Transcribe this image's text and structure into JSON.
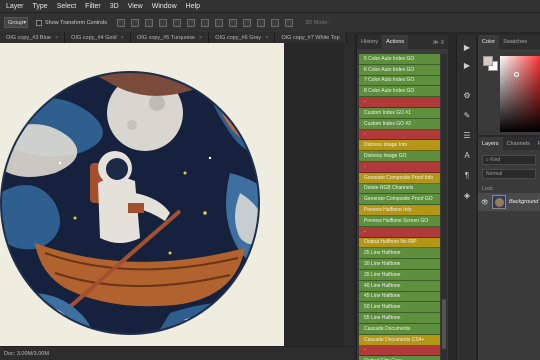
{
  "menu": [
    "Layer",
    "Type",
    "Select",
    "Filter",
    "3D",
    "View",
    "Window",
    "Help"
  ],
  "options_bar": {
    "auto_select_value": "Group",
    "show_transform_label": "Show Transform Controls",
    "mode_3d_label": "3D Mode:"
  },
  "doc_tabs": [
    "OIG copy_#3 Blue",
    "OIG copy_#4 Gold",
    "OIG copy_#5 Turquoise",
    "OIG copy_#6 Gray",
    "OIG copy_#7 White Top"
  ],
  "status": {
    "doc_size": "Doc: 3.00M/3.00M"
  },
  "actions_panel": {
    "tabs": [
      "History",
      "Actions"
    ],
    "active_tab": "Actions",
    "rows": [
      {
        "label": "5 Color Auto Index GO",
        "color": "#5e8f3c"
      },
      {
        "label": "6 Color Auto Index GO",
        "color": "#5e8f3c"
      },
      {
        "label": "7 Color Auto Index GO",
        "color": "#5e8f3c"
      },
      {
        "label": "8 Color Auto Index GO",
        "color": "#5e8f3c"
      },
      {
        "label": "-",
        "color": "#b03a3a"
      },
      {
        "label": "Custom Index GO #1",
        "color": "#5e8f3c"
      },
      {
        "label": "Custom Index GO #2",
        "color": "#5e8f3c"
      },
      {
        "label": "-",
        "color": "#b03a3a"
      },
      {
        "label": "Distress Image Info",
        "color": "#b39613"
      },
      {
        "label": "Distress Image GO",
        "color": "#5e8f3c"
      },
      {
        "label": "-",
        "color": "#b03a3a"
      },
      {
        "label": "Generate Composite Proof Info",
        "color": "#b39613"
      },
      {
        "label": "Delete RGB Channels",
        "color": "#5e8f3c"
      },
      {
        "label": "Generate Composite Proof GO",
        "color": "#5e8f3c"
      },
      {
        "label": "Preview Halftone Info",
        "color": "#b39613"
      },
      {
        "label": "Preview Halftone Screen GO",
        "color": "#5e8f3c"
      },
      {
        "label": "-",
        "color": "#b03a3a"
      },
      {
        "label": "Output Halftone No RIP",
        "color": "#b39613"
      },
      {
        "label": "25 Line Halftone",
        "color": "#5e8f3c"
      },
      {
        "label": "30 Line Halftone",
        "color": "#5e8f3c"
      },
      {
        "label": "35 Line Halftone",
        "color": "#5e8f3c"
      },
      {
        "label": "40 Line Halftone",
        "color": "#5e8f3c"
      },
      {
        "label": "45 Line Halftone",
        "color": "#5e8f3c"
      },
      {
        "label": "50 Line Halftone",
        "color": "#5e8f3c"
      },
      {
        "label": "55 Line Halftone",
        "color": "#5e8f3c"
      },
      {
        "label": "Cascade Documents",
        "color": "#5e8f3c"
      },
      {
        "label": "Cascade Documents CS4+",
        "color": "#b39613"
      },
      {
        "label": "-",
        "color": "#b03a3a"
      },
      {
        "label": "Output Film Gray",
        "color": "#5e8f3c"
      }
    ]
  },
  "color_panel": {
    "tabs": [
      "Color",
      "Swatches"
    ],
    "active_tab": "Color",
    "foreground": "#d9c9c5",
    "background": "#ffffff"
  },
  "layers_panel": {
    "tabs": [
      "Layers",
      "Channels",
      "Paths"
    ],
    "tab_labels_visible": [
      "Layers",
      "Channels",
      "P"
    ],
    "active_tab": "Layers",
    "kind_placeholder": "Kind",
    "blend_mode": "Normal",
    "lock_label": "Lock:",
    "layers": [
      {
        "name": "Background",
        "visible": true
      }
    ]
  },
  "tools": [
    "move-tool",
    "type-tool",
    "settings-tool",
    "brush-tool",
    "adjust-tool",
    "text-tool",
    "paragraph-tool",
    "3d-tool"
  ]
}
